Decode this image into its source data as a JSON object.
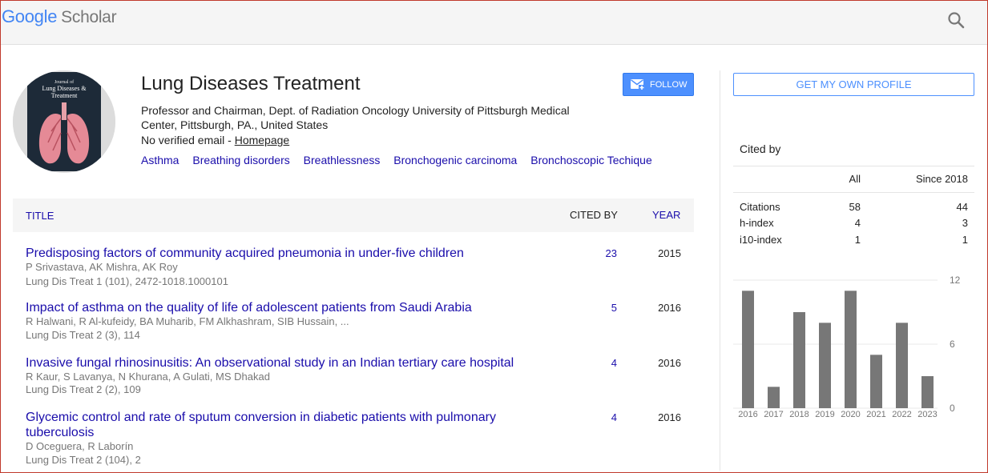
{
  "header": {
    "logo_google": "Google",
    "logo_scholar": "Scholar"
  },
  "profile": {
    "name": "Lung Diseases Treatment",
    "affiliation": "Professor and Chairman, Dept. of Radiation Oncology University of Pittsburgh Medical Center, Pittsburgh, PA., United States",
    "email_text": "No verified email - ",
    "homepage_label": "Homepage",
    "follow_label": "FOLLOW",
    "avatar": {
      "journal_line1": "Journal of",
      "journal_line2": "Lung Diseases &",
      "journal_line3": "Treatment"
    },
    "interests": [
      "Asthma",
      "Breathing disorders",
      "Breathlessness",
      "Bronchogenic carcinoma",
      "Bronchoscopic Techique"
    ]
  },
  "table": {
    "col_title": "TITLE",
    "col_cited": "CITED BY",
    "col_year": "YEAR",
    "rows": [
      {
        "title": "Predisposing factors of community acquired pneumonia in under-five children",
        "authors": "P Srivastava, AK Mishra, AK Roy",
        "source": "Lung Dis Treat 1 (101), 2472-1018.1000101",
        "cited": "23",
        "year": "2015"
      },
      {
        "title": "Impact of asthma on the quality of life of adolescent patients from Saudi Arabia",
        "authors": "R Halwani, R Al-kufeidy, BA Muharib, FM Alkhashram, SIB Hussain, ...",
        "source": "Lung Dis Treat 2 (3), 114",
        "cited": "5",
        "year": "2016"
      },
      {
        "title": "Invasive fungal rhinosinusitis: An observational study in an Indian tertiary care hospital",
        "authors": "R Kaur, S Lavanya, N Khurana, A Gulati, MS Dhakad",
        "source": "Lung Dis Treat 2 (2), 109",
        "cited": "4",
        "year": "2016"
      },
      {
        "title": "Glycemic control and rate of sputum conversion in diabetic patients with pulmonary tuberculosis",
        "authors": "D Oceguera, R Laborín",
        "source": "Lung Dis Treat 2 (104), 2",
        "cited": "4",
        "year": "2016"
      }
    ]
  },
  "sidebar": {
    "own_profile_label": "GET MY OWN PROFILE",
    "cited_by_label": "Cited by",
    "col_all": "All",
    "col_since": "Since 2018",
    "stats": [
      {
        "label": "Citations",
        "all": "58",
        "since": "44"
      },
      {
        "label": "h-index",
        "all": "4",
        "since": "3"
      },
      {
        "label": "i10-index",
        "all": "1",
        "since": "1"
      }
    ]
  },
  "chart_data": {
    "type": "bar",
    "categories": [
      "2016",
      "2017",
      "2018",
      "2019",
      "2020",
      "2021",
      "2022",
      "2023"
    ],
    "values": [
      11,
      2,
      9,
      8,
      11,
      5,
      8,
      3
    ],
    "ylim": [
      0,
      12
    ],
    "yticks": [
      "0",
      "6",
      "12"
    ],
    "grid": true
  },
  "colors": {
    "link": "#1a0dab",
    "follow_bg": "#4d90fe",
    "bar": "#777777",
    "muted": "#777777"
  }
}
